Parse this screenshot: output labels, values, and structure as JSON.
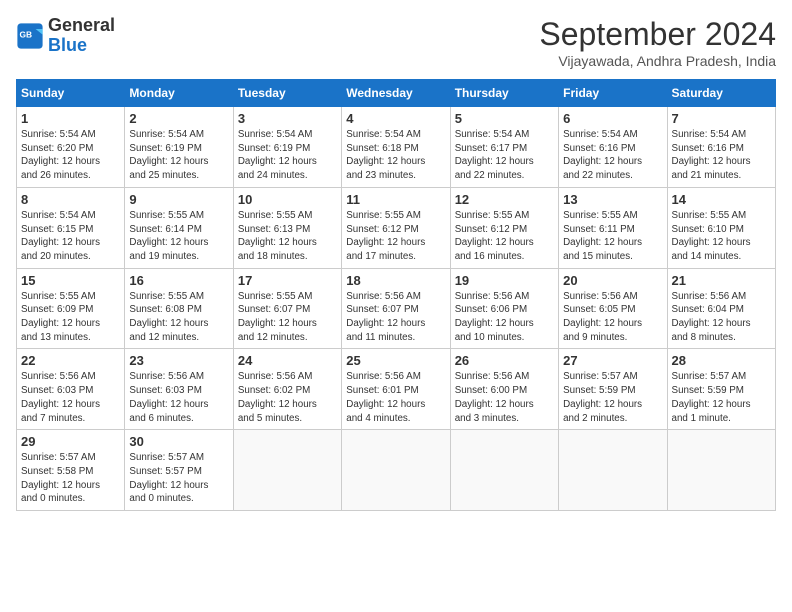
{
  "logo": {
    "line1": "General",
    "line2": "Blue"
  },
  "title": "September 2024",
  "subtitle": "Vijayawada, Andhra Pradesh, India",
  "days_header": [
    "Sunday",
    "Monday",
    "Tuesday",
    "Wednesday",
    "Thursday",
    "Friday",
    "Saturday"
  ],
  "weeks": [
    [
      {
        "day": 1,
        "detail": "Sunrise: 5:54 AM\nSunset: 6:20 PM\nDaylight: 12 hours\nand 26 minutes."
      },
      {
        "day": 2,
        "detail": "Sunrise: 5:54 AM\nSunset: 6:19 PM\nDaylight: 12 hours\nand 25 minutes."
      },
      {
        "day": 3,
        "detail": "Sunrise: 5:54 AM\nSunset: 6:19 PM\nDaylight: 12 hours\nand 24 minutes."
      },
      {
        "day": 4,
        "detail": "Sunrise: 5:54 AM\nSunset: 6:18 PM\nDaylight: 12 hours\nand 23 minutes."
      },
      {
        "day": 5,
        "detail": "Sunrise: 5:54 AM\nSunset: 6:17 PM\nDaylight: 12 hours\nand 22 minutes."
      },
      {
        "day": 6,
        "detail": "Sunrise: 5:54 AM\nSunset: 6:16 PM\nDaylight: 12 hours\nand 22 minutes."
      },
      {
        "day": 7,
        "detail": "Sunrise: 5:54 AM\nSunset: 6:16 PM\nDaylight: 12 hours\nand 21 minutes."
      }
    ],
    [
      {
        "day": 8,
        "detail": "Sunrise: 5:54 AM\nSunset: 6:15 PM\nDaylight: 12 hours\nand 20 minutes."
      },
      {
        "day": 9,
        "detail": "Sunrise: 5:55 AM\nSunset: 6:14 PM\nDaylight: 12 hours\nand 19 minutes."
      },
      {
        "day": 10,
        "detail": "Sunrise: 5:55 AM\nSunset: 6:13 PM\nDaylight: 12 hours\nand 18 minutes."
      },
      {
        "day": 11,
        "detail": "Sunrise: 5:55 AM\nSunset: 6:12 PM\nDaylight: 12 hours\nand 17 minutes."
      },
      {
        "day": 12,
        "detail": "Sunrise: 5:55 AM\nSunset: 6:12 PM\nDaylight: 12 hours\nand 16 minutes."
      },
      {
        "day": 13,
        "detail": "Sunrise: 5:55 AM\nSunset: 6:11 PM\nDaylight: 12 hours\nand 15 minutes."
      },
      {
        "day": 14,
        "detail": "Sunrise: 5:55 AM\nSunset: 6:10 PM\nDaylight: 12 hours\nand 14 minutes."
      }
    ],
    [
      {
        "day": 15,
        "detail": "Sunrise: 5:55 AM\nSunset: 6:09 PM\nDaylight: 12 hours\nand 13 minutes."
      },
      {
        "day": 16,
        "detail": "Sunrise: 5:55 AM\nSunset: 6:08 PM\nDaylight: 12 hours\nand 12 minutes."
      },
      {
        "day": 17,
        "detail": "Sunrise: 5:55 AM\nSunset: 6:07 PM\nDaylight: 12 hours\nand 12 minutes."
      },
      {
        "day": 18,
        "detail": "Sunrise: 5:56 AM\nSunset: 6:07 PM\nDaylight: 12 hours\nand 11 minutes."
      },
      {
        "day": 19,
        "detail": "Sunrise: 5:56 AM\nSunset: 6:06 PM\nDaylight: 12 hours\nand 10 minutes."
      },
      {
        "day": 20,
        "detail": "Sunrise: 5:56 AM\nSunset: 6:05 PM\nDaylight: 12 hours\nand 9 minutes."
      },
      {
        "day": 21,
        "detail": "Sunrise: 5:56 AM\nSunset: 6:04 PM\nDaylight: 12 hours\nand 8 minutes."
      }
    ],
    [
      {
        "day": 22,
        "detail": "Sunrise: 5:56 AM\nSunset: 6:03 PM\nDaylight: 12 hours\nand 7 minutes."
      },
      {
        "day": 23,
        "detail": "Sunrise: 5:56 AM\nSunset: 6:03 PM\nDaylight: 12 hours\nand 6 minutes."
      },
      {
        "day": 24,
        "detail": "Sunrise: 5:56 AM\nSunset: 6:02 PM\nDaylight: 12 hours\nand 5 minutes."
      },
      {
        "day": 25,
        "detail": "Sunrise: 5:56 AM\nSunset: 6:01 PM\nDaylight: 12 hours\nand 4 minutes."
      },
      {
        "day": 26,
        "detail": "Sunrise: 5:56 AM\nSunset: 6:00 PM\nDaylight: 12 hours\nand 3 minutes."
      },
      {
        "day": 27,
        "detail": "Sunrise: 5:57 AM\nSunset: 5:59 PM\nDaylight: 12 hours\nand 2 minutes."
      },
      {
        "day": 28,
        "detail": "Sunrise: 5:57 AM\nSunset: 5:59 PM\nDaylight: 12 hours\nand 1 minute."
      }
    ],
    [
      {
        "day": 29,
        "detail": "Sunrise: 5:57 AM\nSunset: 5:58 PM\nDaylight: 12 hours\nand 0 minutes."
      },
      {
        "day": 30,
        "detail": "Sunrise: 5:57 AM\nSunset: 5:57 PM\nDaylight: 12 hours\nand 0 minutes."
      },
      null,
      null,
      null,
      null,
      null
    ]
  ]
}
